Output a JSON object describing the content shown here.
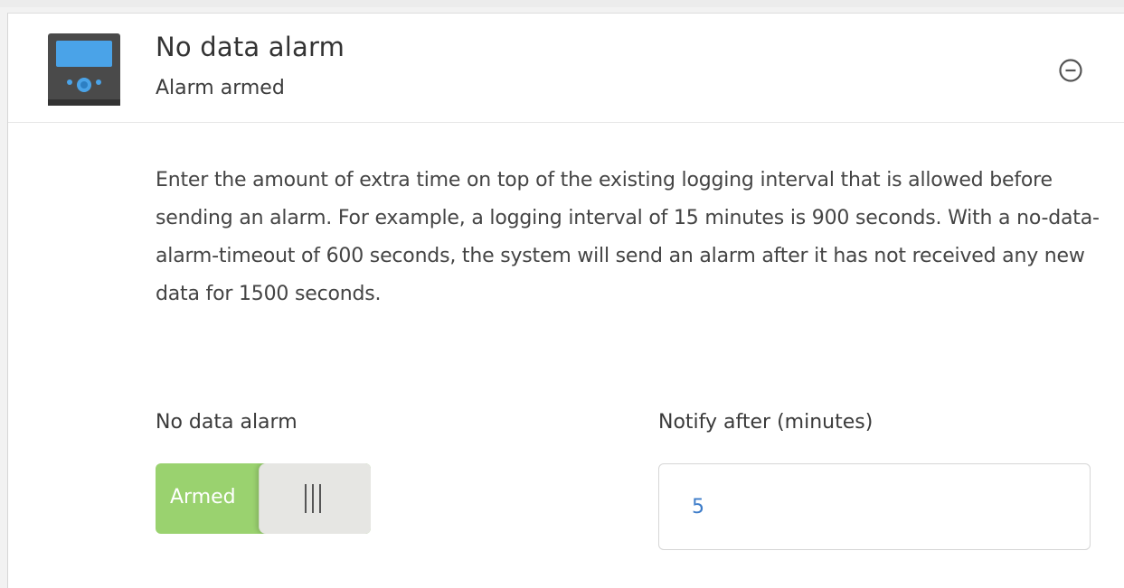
{
  "header": {
    "title": "No data alarm",
    "subtitle": "Alarm armed",
    "device_icon": "gx-device-icon",
    "collapse_icon": "minus-circle-icon"
  },
  "description": "Enter the amount of extra time on top of the existing logging interval that is allowed before sending an alarm. For example, a logging interval of 15 minutes is 900 seconds. With a no-data-alarm-timeout of 600 seconds, the system will send an alarm after it has not received any new data for 1500 seconds.",
  "alarm_toggle": {
    "label": "No data alarm",
    "state_text": "Armed",
    "is_on": true,
    "on_color": "#9ad26f"
  },
  "notify_field": {
    "label": "Notify after (minutes)",
    "value": "5",
    "value_color": "#3d7cc9"
  }
}
